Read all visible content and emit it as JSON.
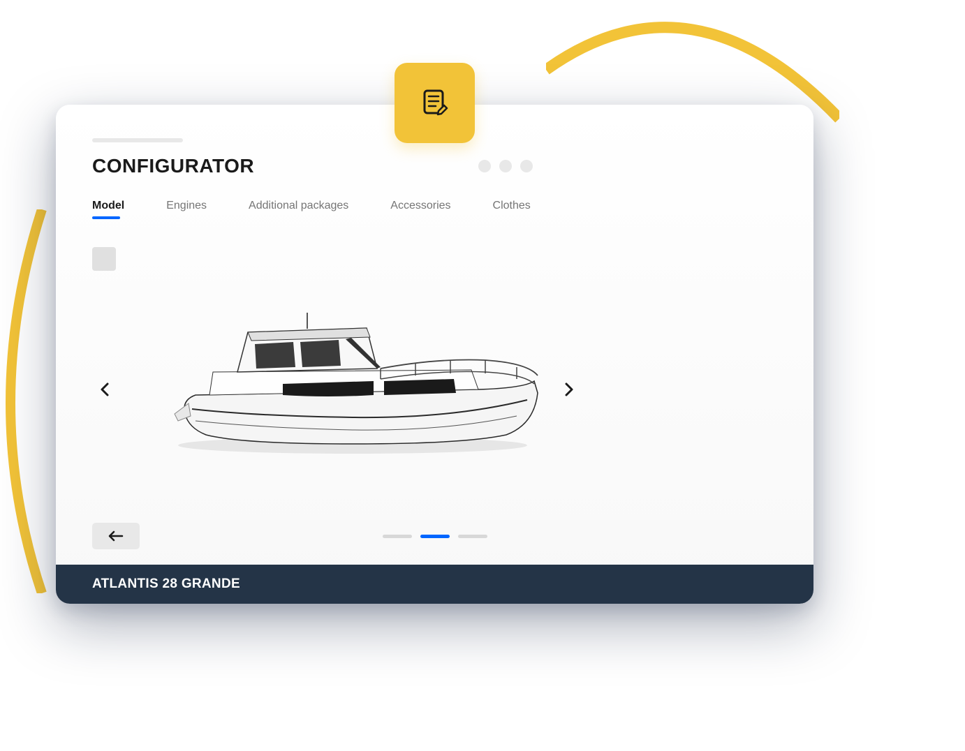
{
  "header": {
    "title": "CONFIGURATOR"
  },
  "tabs": [
    {
      "label": "Model",
      "active": true
    },
    {
      "label": "Engines",
      "active": false
    },
    {
      "label": "Additional packages",
      "active": false
    },
    {
      "label": "Accessories",
      "active": false
    },
    {
      "label": "Clothes",
      "active": false
    }
  ],
  "pagination": {
    "total": 3,
    "active_index": 1
  },
  "footer": {
    "product_name": "ATLANTIS 28 GRANDE"
  },
  "colors": {
    "accent": "#0066FF",
    "badge": "#F2C338",
    "footer_bg": "#243447"
  }
}
